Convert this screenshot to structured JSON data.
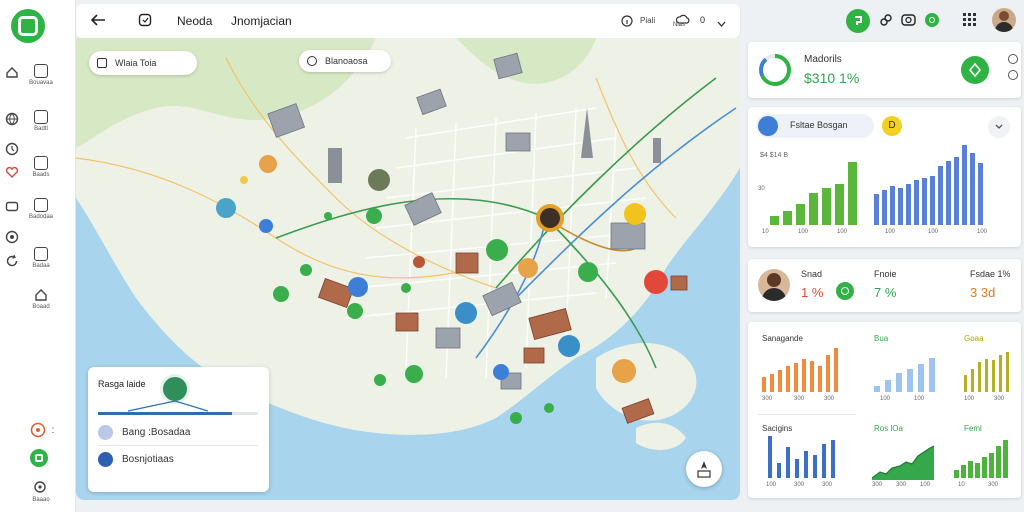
{
  "topbar": {
    "title": "Neoda",
    "subtitle": "Jnomjacian",
    "status_label": "Piali",
    "status_sub": "Nias",
    "count": "0"
  },
  "rail": {
    "items": [
      {
        "label": "Bouavaa"
      },
      {
        "label": "Badtl"
      },
      {
        "label": "Baads"
      },
      {
        "label": "Badodaa"
      },
      {
        "label": "Badaa"
      },
      {
        "label": "Boaad"
      }
    ],
    "bottom_label": "Baaao"
  },
  "map": {
    "search_pill": "Wlaia Toia",
    "filter_pill": "Blanoaosa"
  },
  "route_card": {
    "title": "Rasga laide",
    "rows": [
      {
        "label": "Bang :Bosadaa"
      },
      {
        "label": "Bosnjotiaas"
      }
    ]
  },
  "summary": {
    "label": "Madorils",
    "value": "$310 1%"
  },
  "filter": {
    "label": "Fsltae Bosgan",
    "badge": "D"
  },
  "mini_charts": {
    "left_label": "$4 $14 B",
    "left_ticks": [
      "10",
      "100",
      "100"
    ],
    "left_ylabel": "30",
    "left_values": [
      8,
      12,
      18,
      28,
      32,
      36,
      55
    ],
    "right_ticks": [
      "100",
      "100",
      "100"
    ],
    "right_values": [
      30,
      34,
      38,
      36,
      40,
      44,
      46,
      48,
      58,
      62,
      66,
      78,
      70,
      60
    ]
  },
  "kpis": {
    "items": [
      {
        "label": "Snad",
        "value": "1 %"
      },
      {
        "label": "Fnoie",
        "value": "7 %"
      },
      {
        "label": "Fsdae 1%",
        "value": "3 3d"
      }
    ]
  },
  "charts": {
    "c1": {
      "title": "Sanagande",
      "ticks": [
        "300",
        "300",
        "300"
      ],
      "values": [
        20,
        25,
        30,
        35,
        40,
        45,
        42,
        36,
        50,
        60
      ]
    },
    "c2": {
      "title": "Bua",
      "ticks": [
        "100",
        "100"
      ],
      "values": [
        10,
        20,
        30,
        38,
        45,
        55
      ]
    },
    "c3": {
      "title": "Goaa",
      "ticks": [
        "100",
        "300"
      ],
      "values": [
        25,
        35,
        45,
        50,
        48,
        55,
        60
      ]
    },
    "c4": {
      "title": "Sacigins",
      "ticks": [
        "100",
        "300",
        "300"
      ],
      "values": [
        55,
        20,
        40,
        25,
        35,
        30,
        45,
        50
      ]
    },
    "c5": {
      "title": "Ros lOa",
      "ticks": [
        "300",
        "300",
        "100"
      ]
    },
    "c6": {
      "title": "Feml",
      "ticks": [
        "10",
        "300"
      ],
      "values": [
        10,
        15,
        20,
        18,
        25,
        30,
        38,
        45
      ]
    }
  },
  "colors": {
    "brand_green": "#2fb344",
    "chart_blue": "#5a7fd8",
    "chart_orange": "#ef8a3e",
    "chart_light_blue": "#9cc4ee",
    "chart_olive": "#b5b022",
    "kpi_red": "#e2492f",
    "kpi_green": "#2fa84c"
  }
}
